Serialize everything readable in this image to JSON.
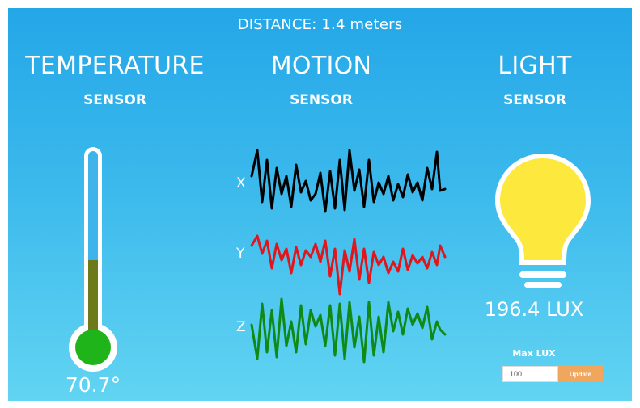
{
  "header": {
    "distance_text": "DISTANCE: 1.4 meters"
  },
  "temperature": {
    "title": "TEMPERATURE",
    "subtitle": "SENSOR",
    "value_text": "70.7°",
    "fill_level": 0.44,
    "fill_color": "#1fb51a",
    "stem_fill_color": "#6c7a1a"
  },
  "motion": {
    "title": "MOTION",
    "subtitle": "SENSOR",
    "axes": [
      {
        "label": "X",
        "color": "#000000"
      },
      {
        "label": "Y",
        "color": "#e0161c"
      },
      {
        "label": "Z",
        "color": "#108a14"
      }
    ]
  },
  "light": {
    "title": "LIGHT",
    "subtitle": "SENSOR",
    "lux_text": "196.4 LUX",
    "bulb_color": "#fde83e",
    "max_lux_label": "Max LUX",
    "max_lux_value": "100",
    "update_label": "Update",
    "update_color": "#f0a65c"
  }
}
